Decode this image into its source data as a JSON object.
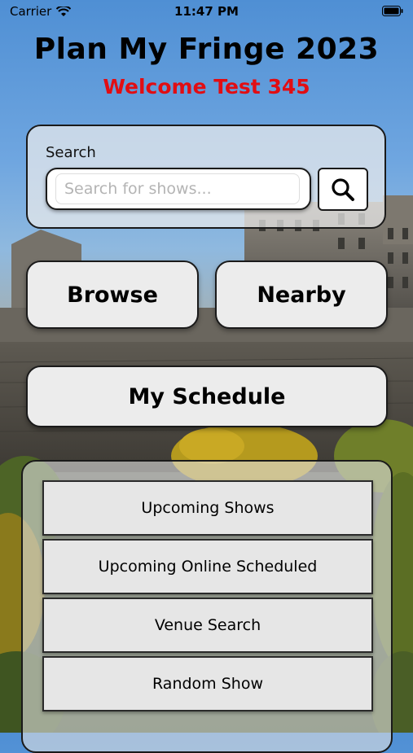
{
  "status": {
    "carrier": "Carrier",
    "time": "11:47 PM"
  },
  "header": {
    "title": "Plan My Fringe 2023",
    "welcome": "Welcome Test 345"
  },
  "search": {
    "label": "Search",
    "placeholder": "Search for shows...",
    "value": "",
    "button_icon": "search-icon"
  },
  "nav": {
    "browse": "Browse",
    "nearby": "Nearby",
    "schedule": "My Schedule"
  },
  "list": {
    "items": [
      {
        "label": "Upcoming Shows"
      },
      {
        "label": "Upcoming Online Scheduled"
      },
      {
        "label": "Venue Search"
      },
      {
        "label": "Random Show"
      }
    ]
  },
  "colors": {
    "welcome": "#e10d13",
    "button_bg": "#ececec",
    "border": "#1a1a1a"
  }
}
